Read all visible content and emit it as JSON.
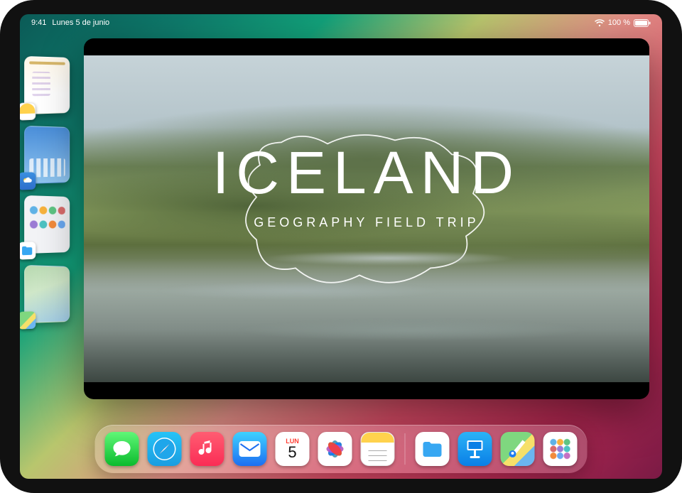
{
  "status": {
    "time": "9:41",
    "date": "Lunes 5 de junio",
    "battery_pct": "100 %"
  },
  "stage": {
    "items": [
      {
        "name": "notes",
        "label": "Notas"
      },
      {
        "name": "weather",
        "label": "Tiempo"
      },
      {
        "name": "files",
        "label": "Archivos"
      },
      {
        "name": "maps",
        "label": "Mapas"
      }
    ]
  },
  "window": {
    "title": "ICELAND",
    "subtitle": "GEOGRAPHY FIELD TRIP"
  },
  "dock": {
    "calendar": {
      "dow": "LUN",
      "day": "5"
    },
    "icons": [
      "Mensajes",
      "Safari",
      "Música",
      "Mail",
      "Calendario",
      "Fotos",
      "Notas",
      "Archivos",
      "Keynote",
      "Mapas",
      "App Library"
    ]
  }
}
